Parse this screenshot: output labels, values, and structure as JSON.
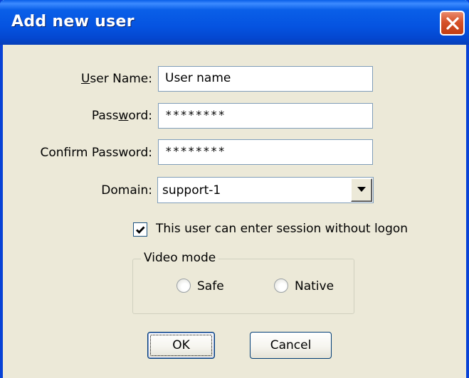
{
  "window": {
    "title": "Add new user"
  },
  "form": {
    "username_label_prefix": "",
    "username_label_mnemonic": "U",
    "username_label_rest": "ser Name:",
    "username_value": "User name",
    "password_label_pre": "Pass",
    "password_label_mnemonic": "w",
    "password_label_post": "ord:",
    "password_value": "********",
    "confirm_label": "Confirm Password:",
    "confirm_value": "********",
    "domain_label": "Domain:",
    "domain_value": "support-1",
    "session_checkbox_label": "This user can enter session without logon",
    "session_checked": true
  },
  "video_mode": {
    "legend": "Video mode",
    "options": [
      {
        "label": "Safe",
        "selected": false
      },
      {
        "label": "Native",
        "selected": false
      }
    ]
  },
  "buttons": {
    "ok_label": "OK",
    "cancel_label": "Cancel"
  },
  "colors": {
    "titlebar": "#0553e0",
    "dialog_bg": "#ece9d8",
    "close_button": "#d6522a",
    "field_border": "#7f9db9"
  },
  "icons": {
    "close": "close-icon",
    "dropdown": "chevron-down-icon",
    "check": "check-icon"
  }
}
